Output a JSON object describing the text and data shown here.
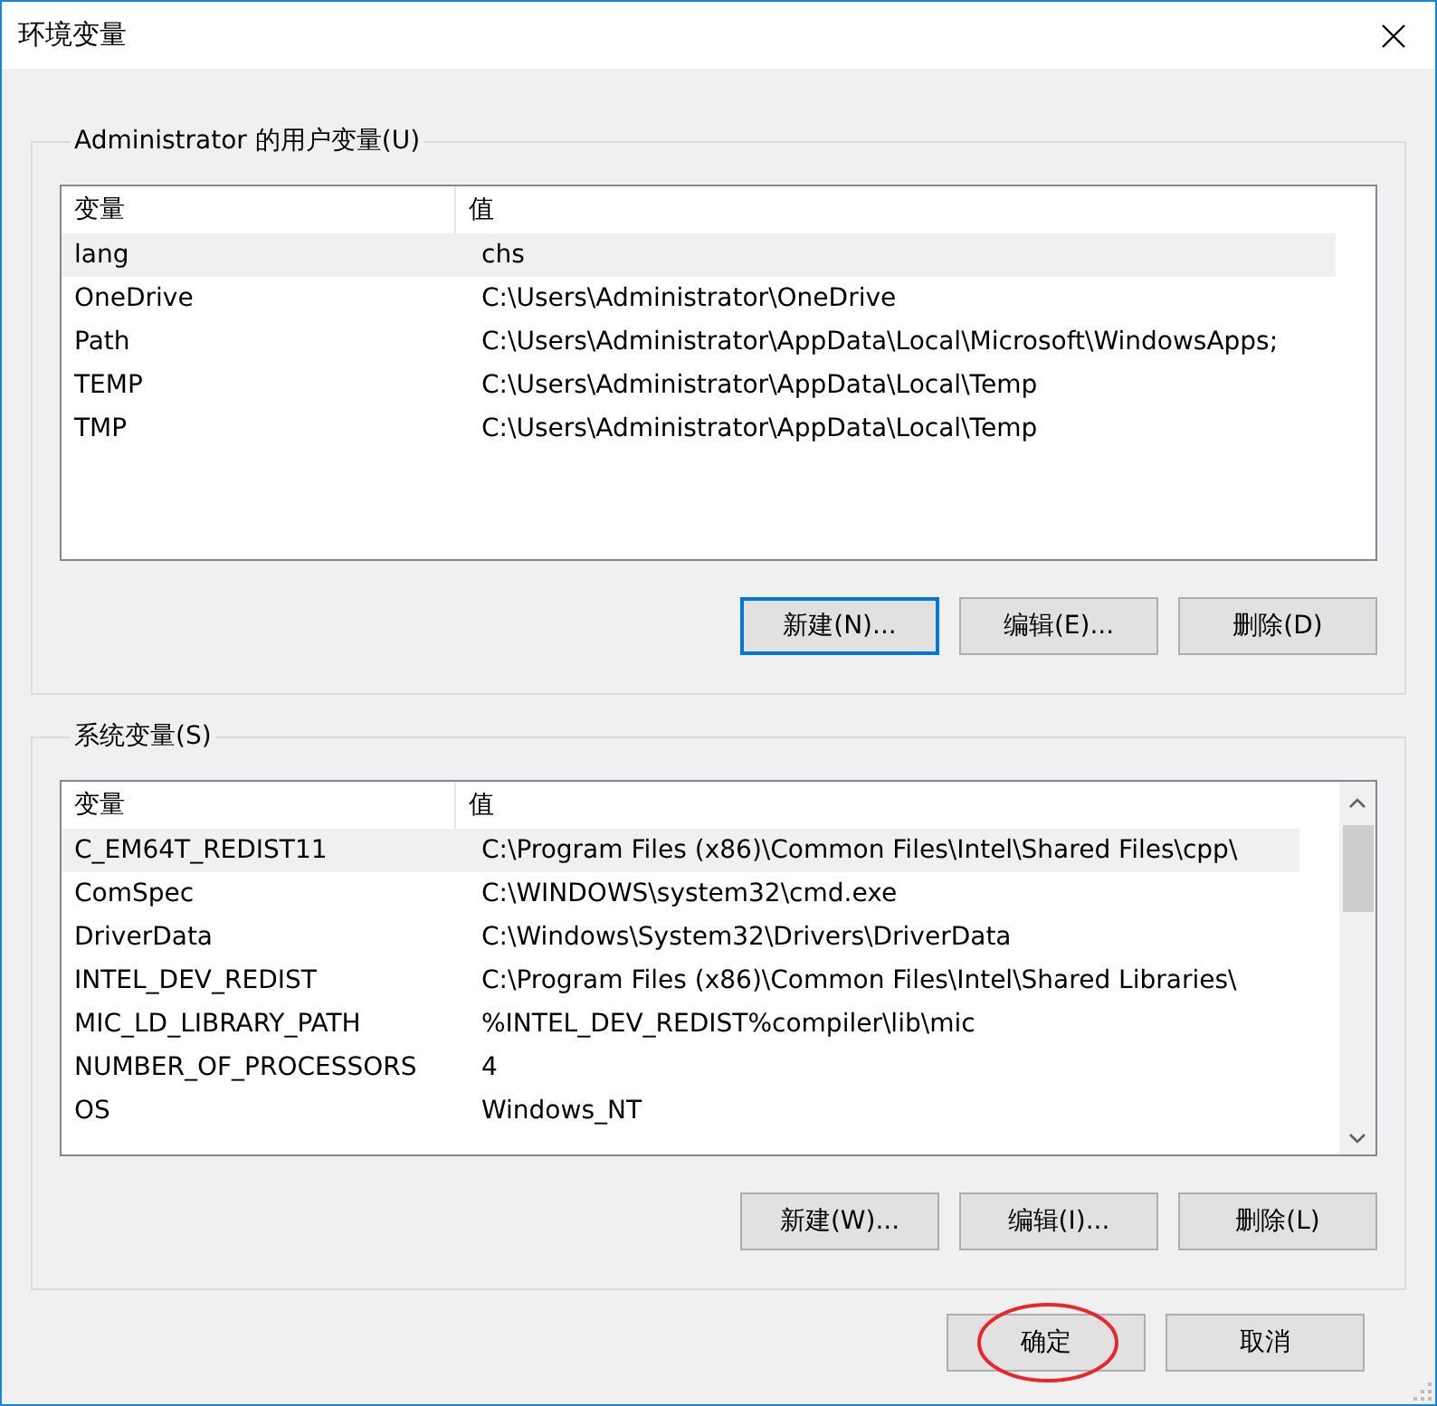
{
  "window": {
    "title": "环境变量"
  },
  "groups": [
    {
      "label": "Administrator 的用户变量(U)",
      "scrollbar": false,
      "columns": [
        "变量",
        "值"
      ],
      "rows": [
        {
          "name": "lang",
          "value": "chs",
          "selected": true
        },
        {
          "name": "OneDrive",
          "value": "C:\\Users\\Administrator\\OneDrive",
          "selected": false
        },
        {
          "name": "Path",
          "value": "C:\\Users\\Administrator\\AppData\\Local\\Microsoft\\WindowsApps;",
          "selected": false
        },
        {
          "name": "TEMP",
          "value": "C:\\Users\\Administrator\\AppData\\Local\\Temp",
          "selected": false
        },
        {
          "name": "TMP",
          "value": "C:\\Users\\Administrator\\AppData\\Local\\Temp",
          "selected": false
        }
      ],
      "buttons": [
        {
          "label": "新建(N)...",
          "focused": true
        },
        {
          "label": "编辑(E)...",
          "focused": false
        },
        {
          "label": "删除(D)",
          "focused": false
        }
      ]
    },
    {
      "label": "系统变量(S)",
      "scrollbar": true,
      "columns": [
        "变量",
        "值"
      ],
      "rows": [
        {
          "name": "C_EM64T_REDIST11",
          "value": "C:\\Program Files (x86)\\Common Files\\Intel\\Shared Files\\cpp\\",
          "selected": true
        },
        {
          "name": "ComSpec",
          "value": "C:\\WINDOWS\\system32\\cmd.exe",
          "selected": false
        },
        {
          "name": "DriverData",
          "value": "C:\\Windows\\System32\\Drivers\\DriverData",
          "selected": false
        },
        {
          "name": "INTEL_DEV_REDIST",
          "value": "C:\\Program Files (x86)\\Common Files\\Intel\\Shared Libraries\\",
          "selected": false
        },
        {
          "name": "MIC_LD_LIBRARY_PATH",
          "value": "%INTEL_DEV_REDIST%compiler\\lib\\mic",
          "selected": false
        },
        {
          "name": "NUMBER_OF_PROCESSORS",
          "value": "4",
          "selected": false
        },
        {
          "name": "OS",
          "value": "Windows_NT",
          "selected": false
        }
      ],
      "buttons": [
        {
          "label": "新建(W)...",
          "focused": false
        },
        {
          "label": "编辑(I)...",
          "focused": false
        },
        {
          "label": "删除(L)",
          "focused": false
        }
      ]
    }
  ],
  "buttons": [
    {
      "label": "确定",
      "highlighted": true
    },
    {
      "label": "取消",
      "highlighted": false
    }
  ]
}
